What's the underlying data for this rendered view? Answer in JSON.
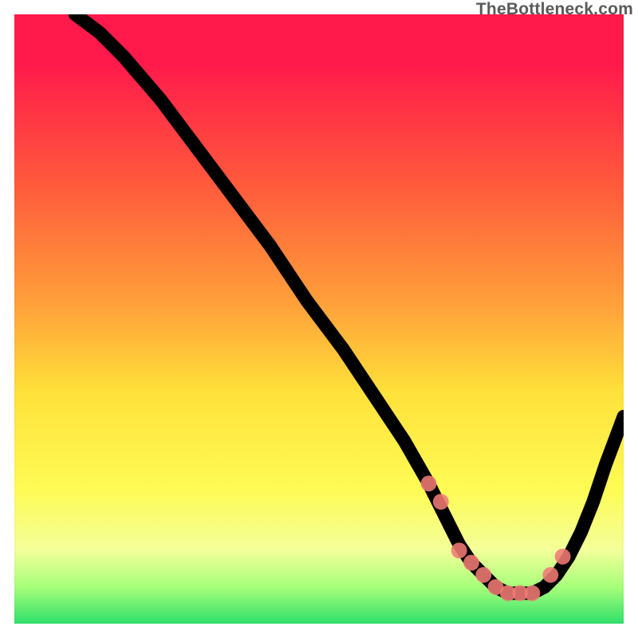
{
  "attribution": "TheBottleneck.com",
  "colors": {
    "red": "#ff1a4b",
    "orangered": "#ff5a3c",
    "orange": "#ffa23a",
    "yellow": "#ffe13a",
    "yellow2": "#fffb55",
    "pale": "#f3ff9a",
    "ltgreen": "#a6ff7a",
    "green": "#2fe06a",
    "dot": "#f07a74"
  },
  "chart_data": {
    "type": "line",
    "title": "",
    "xlabel": "",
    "ylabel": "",
    "xlim": [
      0,
      100
    ],
    "ylim": [
      0,
      100
    ],
    "curve": {
      "x": [
        10,
        14,
        18,
        24,
        30,
        36,
        42,
        48,
        54,
        60,
        64,
        68,
        71,
        73,
        75,
        77,
        79,
        81,
        83,
        85,
        87,
        89,
        91,
        93,
        95,
        97,
        100
      ],
      "y": [
        100,
        97,
        93,
        86,
        78,
        70,
        62,
        53,
        45,
        36,
        30,
        23,
        17,
        13,
        10,
        8,
        6,
        5,
        5,
        5,
        6,
        8,
        11,
        15,
        20,
        26,
        34
      ]
    },
    "dots": {
      "x": [
        68,
        70,
        73,
        75,
        77,
        79,
        81,
        83,
        85,
        88,
        90
      ],
      "y": [
        23,
        20,
        12,
        10,
        8,
        6,
        5,
        5,
        5,
        8,
        11
      ]
    }
  }
}
